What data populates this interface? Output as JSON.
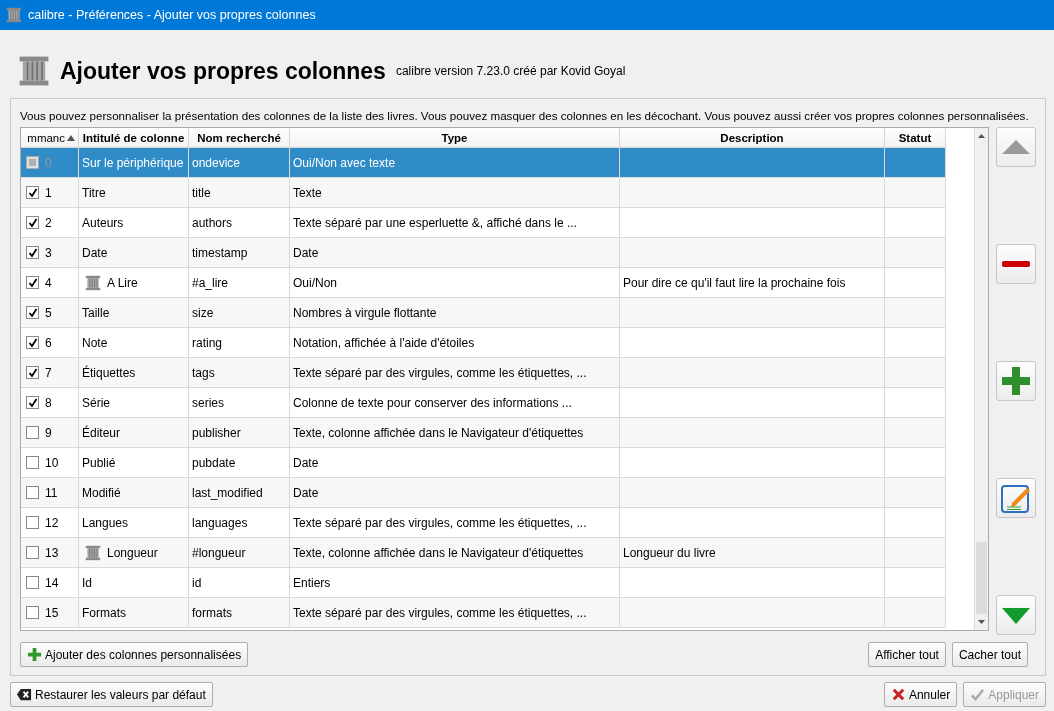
{
  "window": {
    "title": "calibre - Préférences - Ajouter vos propres colonnes"
  },
  "header": {
    "title": "Ajouter vos propres colonnes",
    "subtitle": "calibre version 7.23.0 créé par Kovid Goyal"
  },
  "description": "Vous pouvez personnaliser la présentation des colonnes de la liste des livres. Vous pouvez masquer des colonnes en les décochant. Vous pouvez aussi créer vos propres colonnes personnalisées.",
  "table": {
    "columns": [
      "mmanc",
      "Intitulé de colonne",
      "Nom recherché",
      "Type",
      "Description",
      "Statut"
    ],
    "rows": [
      {
        "number": "0",
        "checked": false,
        "disabled": true,
        "selected": true,
        "custom": false,
        "heading": "Sur le périphérique",
        "lookup": "ondevice",
        "type": "Oui/Non avec texte",
        "description": ""
      },
      {
        "number": "1",
        "checked": true,
        "disabled": false,
        "selected": false,
        "custom": false,
        "heading": "Titre",
        "lookup": "title",
        "type": "Texte",
        "description": ""
      },
      {
        "number": "2",
        "checked": true,
        "disabled": false,
        "selected": false,
        "custom": false,
        "heading": "Auteurs",
        "lookup": "authors",
        "type": "Texte séparé par une esperluette &, affiché dans le ...",
        "description": ""
      },
      {
        "number": "3",
        "checked": true,
        "disabled": false,
        "selected": false,
        "custom": false,
        "heading": "Date",
        "lookup": "timestamp",
        "type": "Date",
        "description": ""
      },
      {
        "number": "4",
        "checked": true,
        "disabled": false,
        "selected": false,
        "custom": true,
        "heading": "A Lire",
        "lookup": "#a_lire",
        "type": "Oui/Non",
        "description": "Pour dire ce qu'il faut lire la prochaine fois"
      },
      {
        "number": "5",
        "checked": true,
        "disabled": false,
        "selected": false,
        "custom": false,
        "heading": "Taille",
        "lookup": "size",
        "type": "Nombres à virgule flottante",
        "description": ""
      },
      {
        "number": "6",
        "checked": true,
        "disabled": false,
        "selected": false,
        "custom": false,
        "heading": "Note",
        "lookup": "rating",
        "type": "Notation, affichée à l'aide d'étoiles",
        "description": ""
      },
      {
        "number": "7",
        "checked": true,
        "disabled": false,
        "selected": false,
        "custom": false,
        "heading": "Étiquettes",
        "lookup": "tags",
        "type": "Texte séparé par des virgules, comme les étiquettes, ...",
        "description": ""
      },
      {
        "number": "8",
        "checked": true,
        "disabled": false,
        "selected": false,
        "custom": false,
        "heading": "Série",
        "lookup": "series",
        "type": "Colonne de texte pour conserver des informations ...",
        "description": ""
      },
      {
        "number": "9",
        "checked": false,
        "disabled": false,
        "selected": false,
        "custom": false,
        "heading": "Éditeur",
        "lookup": "publisher",
        "type": "Texte, colonne affichée dans le Navigateur d'étiquettes",
        "description": ""
      },
      {
        "number": "10",
        "checked": false,
        "disabled": false,
        "selected": false,
        "custom": false,
        "heading": "Publié",
        "lookup": "pubdate",
        "type": "Date",
        "description": ""
      },
      {
        "number": "11",
        "checked": false,
        "disabled": false,
        "selected": false,
        "custom": false,
        "heading": "Modifié",
        "lookup": "last_modified",
        "type": "Date",
        "description": ""
      },
      {
        "number": "12",
        "checked": false,
        "disabled": false,
        "selected": false,
        "custom": false,
        "heading": "Langues",
        "lookup": "languages",
        "type": "Texte séparé par des virgules, comme les étiquettes, ...",
        "description": ""
      },
      {
        "number": "13",
        "checked": false,
        "disabled": false,
        "selected": false,
        "custom": true,
        "heading": "Longueur",
        "lookup": "#longueur",
        "type": "Texte, colonne affichée dans le Navigateur d'étiquettes",
        "description": "Longueur du livre"
      },
      {
        "number": "14",
        "checked": false,
        "disabled": false,
        "selected": false,
        "custom": false,
        "heading": "Id",
        "lookup": "id",
        "type": "Entiers",
        "description": ""
      },
      {
        "number": "15",
        "checked": false,
        "disabled": false,
        "selected": false,
        "custom": false,
        "heading": "Formats",
        "lookup": "formats",
        "type": "Texte séparé par des virgules, comme les étiquettes, ...",
        "description": ""
      }
    ]
  },
  "group_buttons": [
    {
      "kind": "add",
      "label": "Ajouter des colonnes personnalisées"
    },
    {
      "kind": "show",
      "label": "Afficher tout"
    },
    {
      "kind": "hide",
      "label": "Cacher tout"
    }
  ],
  "dialog_buttons": [
    {
      "kind": "restore",
      "label": "Restaurer les valeurs par défaut",
      "disabled": false
    },
    {
      "kind": "cancel",
      "label": "Annuler",
      "disabled": false
    },
    {
      "kind": "apply",
      "label": "Appliquer",
      "disabled": true
    }
  ]
}
